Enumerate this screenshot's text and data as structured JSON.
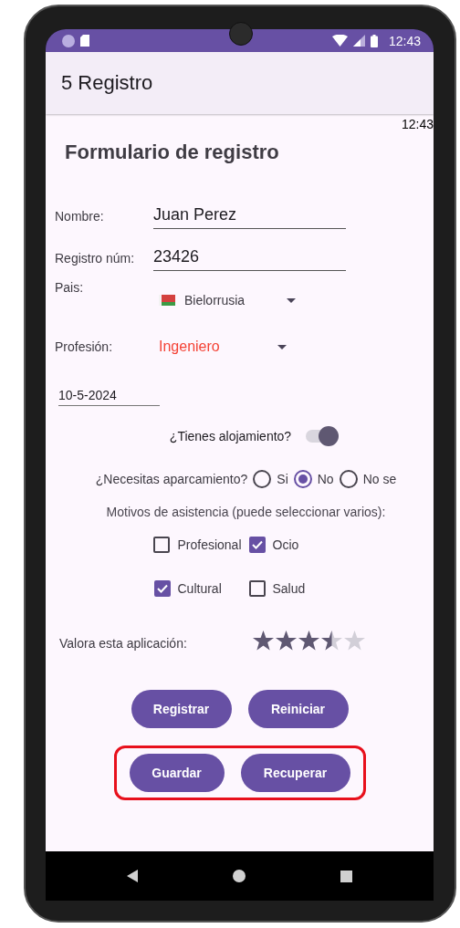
{
  "status_bar": {
    "time": "12:43"
  },
  "app_bar": {
    "title": "5 Registro"
  },
  "clock": "12:43",
  "form": {
    "title": "Formulario de registro",
    "fields": [
      {
        "label": "Nombre:",
        "value": "Juan Perez"
      },
      {
        "label": "Registro núm:",
        "value": "23426"
      }
    ],
    "country": {
      "label": "Pais:",
      "value": "Bielorrusia"
    },
    "profession": {
      "label": "Profesión:",
      "value": "Ingeniero"
    },
    "date": "10-5-2024",
    "accommodation": {
      "label": "¿Tienes alojamiento?",
      "on": true
    },
    "parking": {
      "label": "¿Necesitas aparcamiento?",
      "options": [
        {
          "label": "Si",
          "selected": false
        },
        {
          "label": "No",
          "selected": true
        },
        {
          "label": "No se",
          "selected": false
        }
      ]
    },
    "reasons": {
      "label": "Motivos de asistencia (puede seleccionar varios):",
      "rows": [
        {
          "options": [
            {
              "label": "Profesional",
              "checked": false
            },
            {
              "label": "Ocio",
              "checked": true
            }
          ]
        },
        {
          "options": [
            {
              "label": "Cultural",
              "checked": true
            },
            {
              "label": "Salud",
              "checked": false
            }
          ]
        }
      ]
    },
    "rating": {
      "label": "Valora esta aplicación:",
      "stars": 3.5
    },
    "button_rows": [
      {
        "highlighted": false,
        "buttons": [
          "Registrar",
          "Reiniciar"
        ]
      },
      {
        "highlighted": true,
        "buttons": [
          "Guardar",
          "Recuperar"
        ]
      }
    ]
  }
}
